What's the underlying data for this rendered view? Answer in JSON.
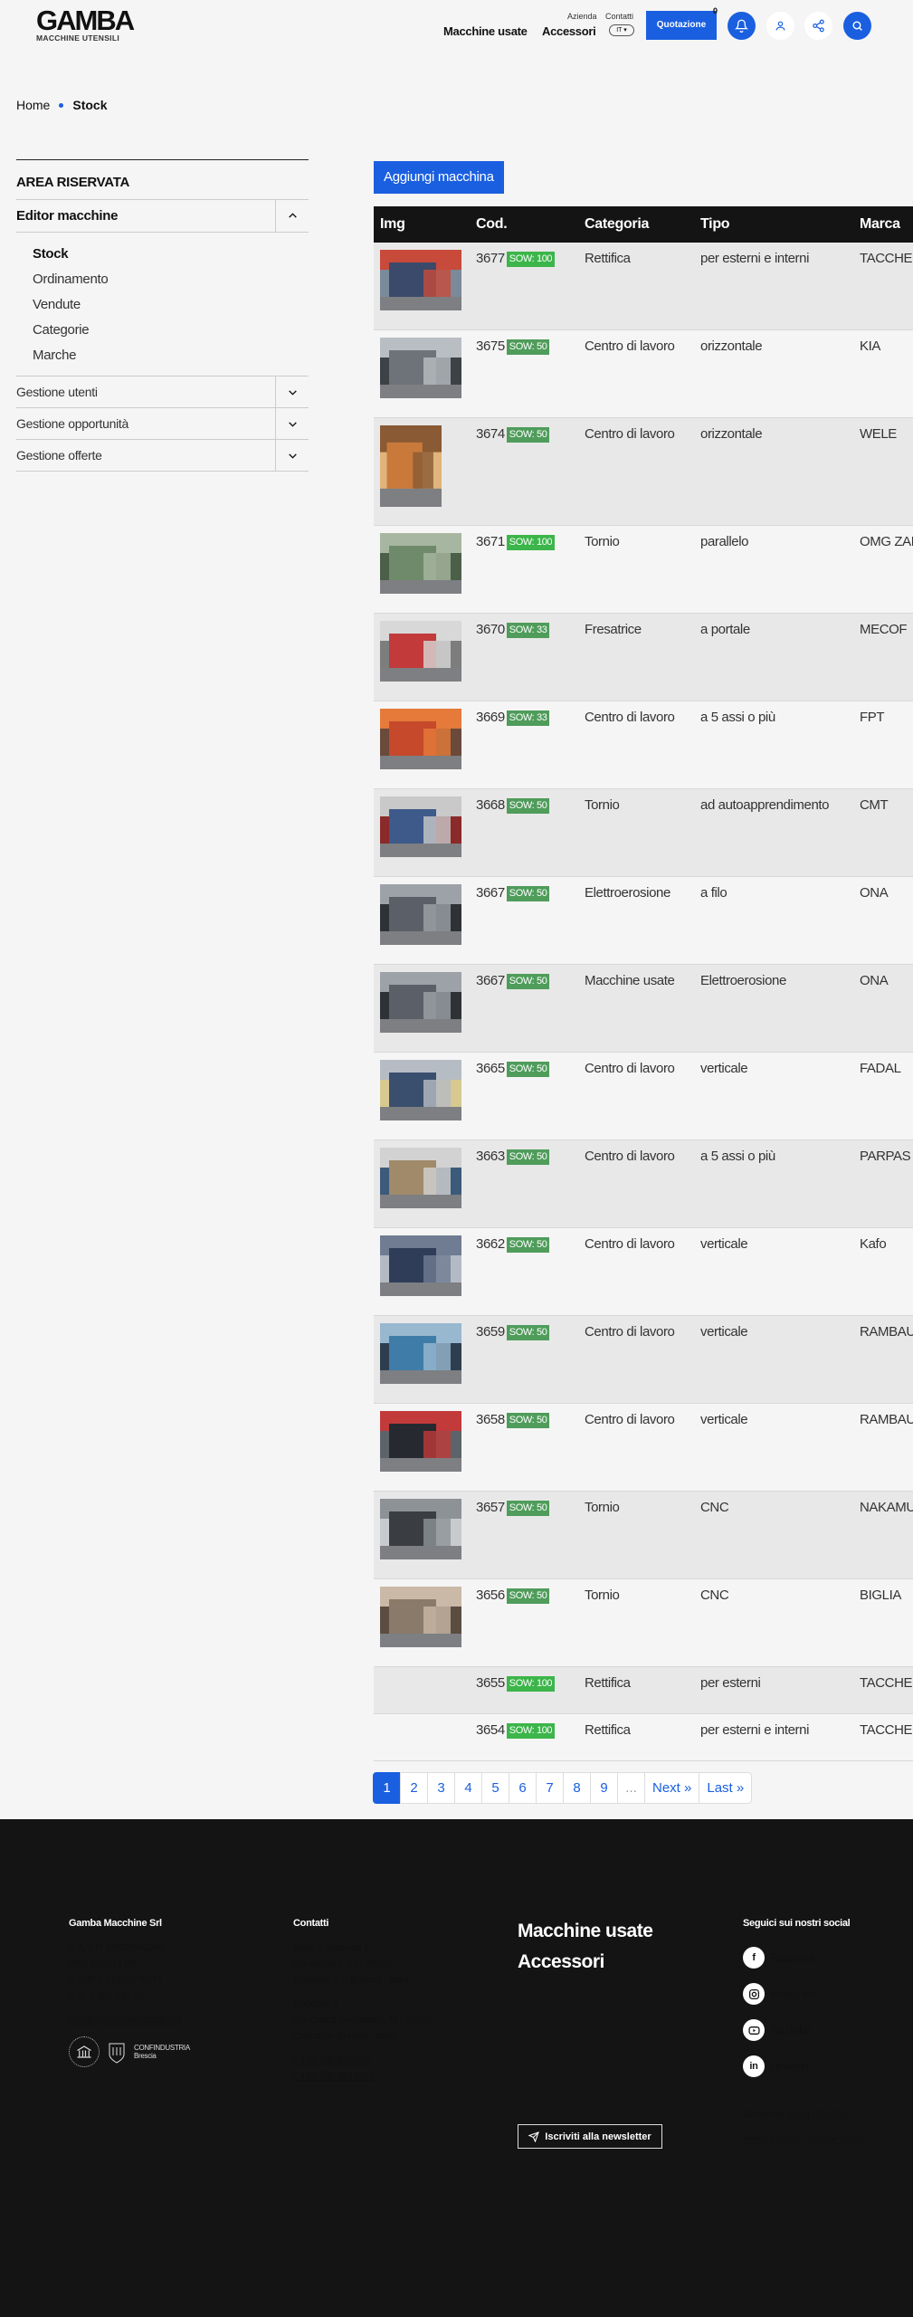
{
  "header": {
    "logo": "GAMBA",
    "logo_sub": "MACCHINE UTENSILI",
    "nav_macchine": "Macchine usate",
    "nav_accessori": "Accessori",
    "nav_azienda": "Azienda",
    "nav_contatti": "Contatti",
    "lang": "IT",
    "quote_label": "Quotazione",
    "quote_count": "0"
  },
  "breadcrumb": {
    "home": "Home",
    "current": "Stock"
  },
  "sidebar": {
    "title": "AREA RISERVATA",
    "editor": "Editor macchine",
    "editor_items": [
      "Stock",
      "Ordinamento",
      "Vendute",
      "Categorie",
      "Marche"
    ],
    "sections": [
      "Gestione utenti",
      "Gestione opportunità",
      "Gestione offerte"
    ]
  },
  "actions": {
    "add_machine": "Aggiungi macchina"
  },
  "table": {
    "headers": [
      "Img",
      "Cod.",
      "Categoria",
      "Tipo",
      "Marca"
    ],
    "rows": [
      {
        "cod": "3677",
        "badge": "SOW: 100",
        "cat": "Rettifica",
        "tipo": "per esterni e interni",
        "marca": "TACCHELLA"
      },
      {
        "cod": "3675",
        "badge": "SOW: 50",
        "cat": "Centro di lavoro",
        "tipo": "orizzontale",
        "marca": "KIA"
      },
      {
        "cod": "3674",
        "badge": "SOW: 50",
        "cat": "Centro di lavoro",
        "tipo": "orizzontale",
        "marca": "WELE"
      },
      {
        "cod": "3671",
        "badge": "SOW: 100",
        "cat": "Tornio",
        "tipo": "parallelo",
        "marca": "OMG ZANOTTI"
      },
      {
        "cod": "3670",
        "badge": "SOW: 33",
        "cat": "Fresatrice",
        "tipo": "a portale",
        "marca": "MECOF"
      },
      {
        "cod": "3669",
        "badge": "SOW: 33",
        "cat": "Centro di lavoro",
        "tipo": "a 5 assi o più",
        "marca": "FPT"
      },
      {
        "cod": "3668",
        "badge": "SOW: 50",
        "cat": "Tornio",
        "tipo": "ad autoapprendimento",
        "marca": "CMT"
      },
      {
        "cod": "3667",
        "badge": "SOW: 50",
        "cat": "Elettroerosione",
        "tipo": "a filo",
        "marca": "ONA"
      },
      {
        "cod": "3667",
        "badge": "SOW: 50",
        "cat": "Macchine usate",
        "tipo": "Elettroerosione",
        "marca": "ONA"
      },
      {
        "cod": "3665",
        "badge": "SOW: 50",
        "cat": "Centro di lavoro",
        "tipo": "verticale",
        "marca": "FADAL"
      },
      {
        "cod": "3663",
        "badge": "SOW: 50",
        "cat": "Centro di lavoro",
        "tipo": "a 5 assi o più",
        "marca": "PARPAS"
      },
      {
        "cod": "3662",
        "badge": "SOW: 50",
        "cat": "Centro di lavoro",
        "tipo": "verticale",
        "marca": "Kafo"
      },
      {
        "cod": "3659",
        "badge": "SOW: 50",
        "cat": "Centro di lavoro",
        "tipo": "verticale",
        "marca": "RAMBAUDI"
      },
      {
        "cod": "3658",
        "badge": "SOW: 50",
        "cat": "Centro di lavoro",
        "tipo": "verticale",
        "marca": "RAMBAUDI"
      },
      {
        "cod": "3657",
        "badge": "SOW: 50",
        "cat": "Tornio",
        "tipo": "CNC",
        "marca": "NAKAMURA"
      },
      {
        "cod": "3656",
        "badge": "SOW: 50",
        "cat": "Tornio",
        "tipo": "CNC",
        "marca": "BIGLIA"
      },
      {
        "cod": "3655",
        "badge": "SOW: 100",
        "cat": "Rettifica",
        "tipo": "per esterni",
        "marca": "TACCHELLA"
      },
      {
        "cod": "3654",
        "badge": "SOW: 100",
        "cat": "Rettifica",
        "tipo": "per esterni e interni",
        "marca": "TACCHELLA"
      }
    ]
  },
  "pagination": [
    "1",
    "2",
    "3",
    "4",
    "5",
    "6",
    "7",
    "8",
    "9",
    "...",
    "Next »",
    "Last »"
  ],
  "footer": {
    "company": {
      "title": "Gamba Macchine Srl",
      "lines": [
        "V.A.T. IT 00639540988",
        "REA 248813 BS",
        "C.F./R.I. 01581570171",
        "C.S. € 802.165,00"
      ],
      "email": "offerte@gambamacchine.it",
      "confindustria": "CONFINDUSTRIA",
      "confindustria_sub": "Brescia"
    },
    "contacts": {
      "title": "Contatti",
      "sede": [
        "Sede e deposito 1",
        "Via Artigiani, 32 - 25063",
        "Gardone V.T. Brescia - Italia"
      ],
      "deposito": [
        "Deposito 2",
        "Via Caduti del Lavoro, 41 - 25030",
        "Coccaglio Brescia - Italia"
      ],
      "phones": [
        "t. +39 030 831096",
        "t. +39 030 8913312"
      ]
    },
    "links": [
      "Macchine usate",
      "Accessori"
    ],
    "newsletter": "Iscriviti alla newsletter",
    "social": {
      "title": "Seguici sui nostri social",
      "items": [
        "Facebook",
        "Instagram",
        "YouTube",
        "Linkedin"
      ]
    },
    "design_by": "Design by",
    "dexa": "Dexa",
    "credits": "Credits",
    "privacy": "Privacy policy",
    "cookie": "Cookie policy"
  }
}
